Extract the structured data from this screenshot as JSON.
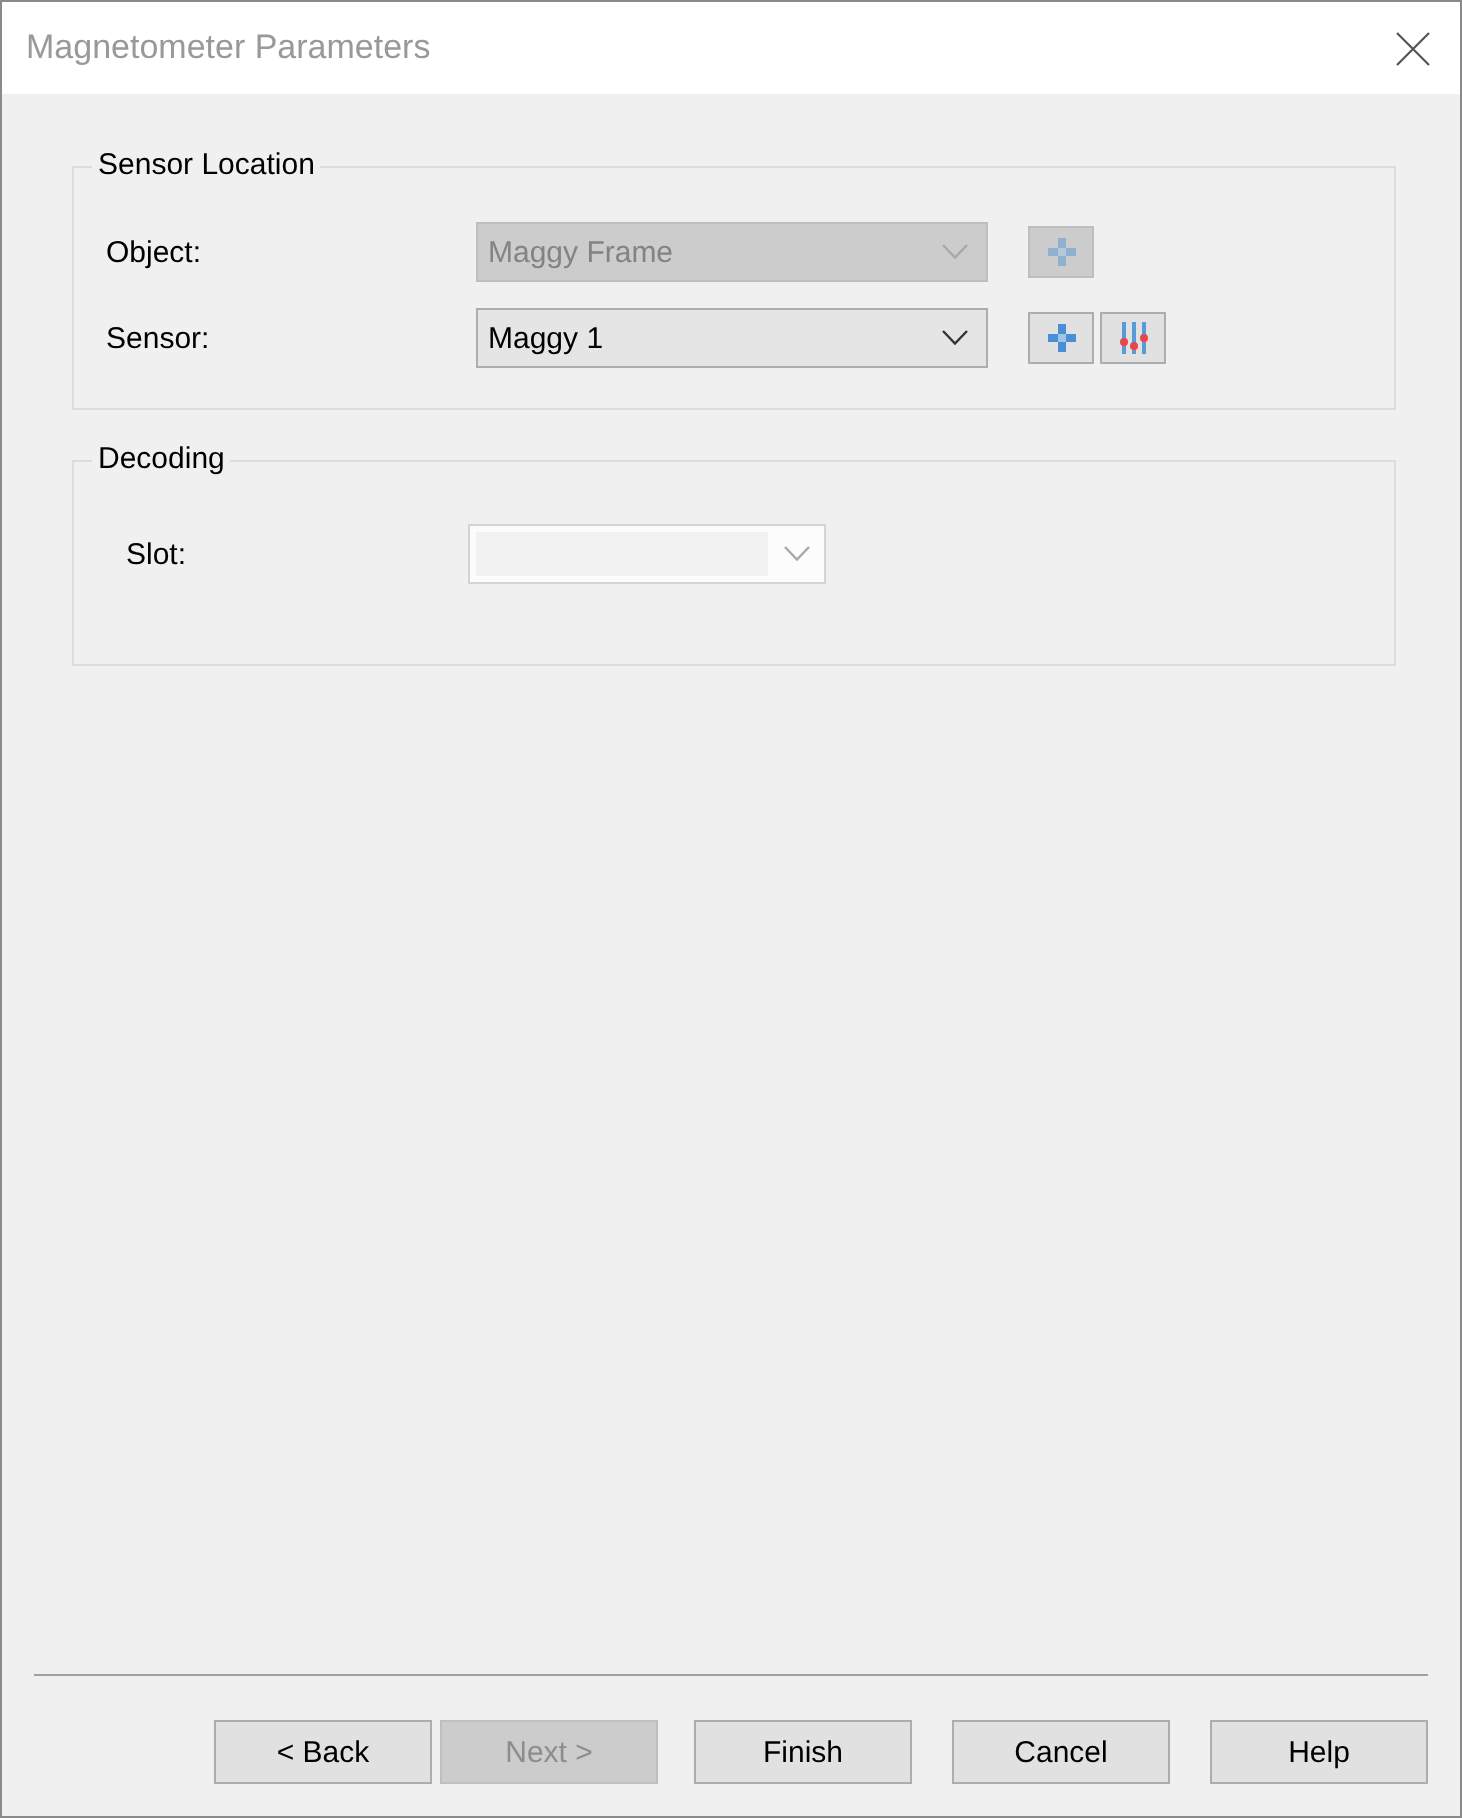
{
  "window": {
    "title": "Magnetometer Parameters"
  },
  "groups": [
    {
      "title": "Sensor Location",
      "fields": [
        {
          "kind": "dropdown",
          "label": "Object:",
          "value": "Maggy Frame",
          "disabled": true,
          "buttons": [
            {
              "kind": "add",
              "disabled": true
            }
          ]
        },
        {
          "kind": "dropdown",
          "label": "Sensor:",
          "value": "Maggy 1",
          "disabled": false,
          "buttons": [
            {
              "kind": "add",
              "disabled": false
            },
            {
              "kind": "adjust",
              "disabled": false
            }
          ]
        }
      ]
    },
    {
      "title": "Decoding",
      "fields": [
        {
          "kind": "editable",
          "label": "Slot:",
          "disabled": true
        }
      ]
    }
  ],
  "wizard_buttons": {
    "navigation": [
      {
        "label": "< Back",
        "disabled": false
      },
      {
        "label": "Next >",
        "disabled": true
      }
    ],
    "actions": [
      {
        "label": "Finish",
        "disabled": false
      },
      {
        "label": "Cancel",
        "disabled": false
      },
      {
        "label": "Help",
        "disabled": false
      }
    ]
  }
}
